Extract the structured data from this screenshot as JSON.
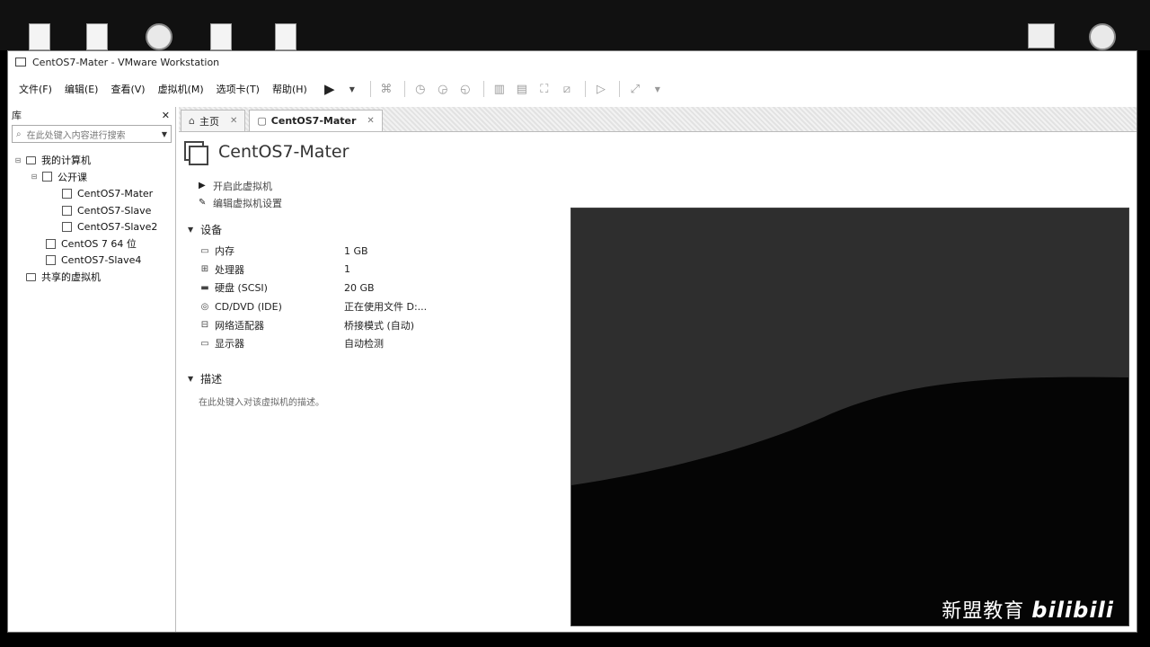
{
  "window": {
    "title": "CentOS7-Mater - VMware Workstation"
  },
  "menu": [
    "文件(F)",
    "编辑(E)",
    "查看(V)",
    "虚拟机(M)",
    "选项卡(T)",
    "帮助(H)"
  ],
  "library": {
    "title": "库",
    "close": "✕",
    "search_placeholder": "在此处键入内容进行搜索",
    "tree": [
      {
        "label": "我的计算机",
        "level": 0
      },
      {
        "label": "公开课",
        "level": 1
      },
      {
        "label": "CentOS7-Mater",
        "level": 2
      },
      {
        "label": "CentOS7-Slave",
        "level": 2
      },
      {
        "label": "CentOS7-Slave2",
        "level": 2
      },
      {
        "label": "CentOS 7 64 位",
        "level": 1
      },
      {
        "label": "CentOS7-Slave4",
        "level": 1
      },
      {
        "label": "共享的虚拟机",
        "level": 0
      }
    ]
  },
  "tabs": [
    {
      "label": "主页",
      "close": "✕"
    },
    {
      "label": "CentOS7-Mater",
      "close": "✕"
    }
  ],
  "vm": {
    "name": "CentOS7-Mater",
    "actions": [
      "开启此虚拟机",
      "编辑虚拟机设置"
    ],
    "devices_heading": "设备",
    "devices": [
      {
        "name": "内存",
        "value": "1 GB",
        "icon": "memory-icon"
      },
      {
        "name": "处理器",
        "value": "1",
        "icon": "cpu-icon"
      },
      {
        "name": "硬盘 (SCSI)",
        "value": "20 GB",
        "icon": "disk-icon"
      },
      {
        "name": "CD/DVD (IDE)",
        "value": "正在使用文件 D:...",
        "icon": "cd-icon"
      },
      {
        "name": "网络适配器",
        "value": "桥接模式 (自动)",
        "icon": "network-icon"
      },
      {
        "name": "显示器",
        "value": "自动检测",
        "icon": "display-icon"
      }
    ],
    "desc_heading": "描述",
    "desc_placeholder": "在此处键入对该虚拟机的描述。"
  },
  "watermark": {
    "text": "新盟教育",
    "logo": "bilibili"
  }
}
